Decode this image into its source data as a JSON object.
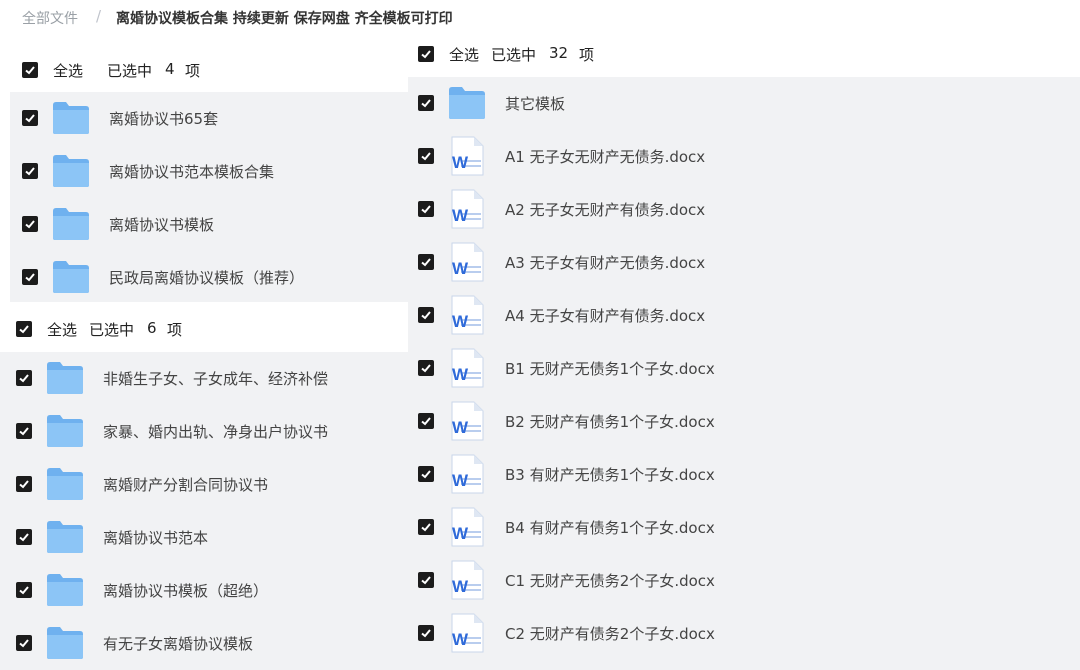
{
  "breadcrumb": {
    "root": "全部文件",
    "separator": "/",
    "current": "离婚协议模板合集 持续更新 保存网盘 齐全模板可打印"
  },
  "panel_a": {
    "select_all": "全选",
    "selected_prefix": "已选中",
    "selected_count": "4",
    "selected_suffix": "项",
    "items": [
      {
        "name": "离婚协议书65套",
        "icon": "folder-icon"
      },
      {
        "name": "离婚协议书范本模板合集",
        "icon": "folder-icon"
      },
      {
        "name": "离婚协议书模板",
        "icon": "folder-icon"
      },
      {
        "name": "民政局离婚协议模板（推荐）",
        "icon": "folder-icon"
      }
    ]
  },
  "panel_b": {
    "select_all": "全选",
    "selected_prefix": "已选中",
    "selected_count": "6",
    "selected_suffix": "项",
    "items": [
      {
        "name": "非婚生子女、子女成年、经济补偿",
        "icon": "folder-icon"
      },
      {
        "name": "家暴、婚内出轨、净身出户协议书",
        "icon": "folder-icon"
      },
      {
        "name": "离婚财产分割合同协议书",
        "icon": "folder-icon"
      },
      {
        "name": "离婚协议书范本",
        "icon": "folder-icon"
      },
      {
        "name": "离婚协议书模板（超绝）",
        "icon": "folder-icon"
      },
      {
        "name": "有无子女离婚协议模板",
        "icon": "folder-icon"
      }
    ]
  },
  "panel_c": {
    "select_all": "全选",
    "selected_prefix": "已选中",
    "selected_count": "32",
    "selected_suffix": "项",
    "items": [
      {
        "name": "其它模板",
        "icon": "folder-icon"
      },
      {
        "name": "A1 无子女无财产无债务.docx",
        "icon": "word-doc-icon"
      },
      {
        "name": "A2 无子女无财产有债务.docx",
        "icon": "word-doc-icon"
      },
      {
        "name": "A3 无子女有财产无债务.docx",
        "icon": "word-doc-icon"
      },
      {
        "name": "A4 无子女有财产有债务.docx",
        "icon": "word-doc-icon"
      },
      {
        "name": "B1 无财产无债务1个子女.docx",
        "icon": "word-doc-icon"
      },
      {
        "name": "B2 无财产有债务1个子女.docx",
        "icon": "word-doc-icon"
      },
      {
        "name": "B3 有财产无债务1个子女.docx",
        "icon": "word-doc-icon"
      },
      {
        "name": "B4 有财产有债务1个子女.docx",
        "icon": "word-doc-icon"
      },
      {
        "name": "C1 无财产无债务2个子女.docx",
        "icon": "word-doc-icon"
      },
      {
        "name": "C2 无财产有债务2个子女.docx",
        "icon": "word-doc-icon"
      }
    ]
  },
  "colors": {
    "panel_bg": "#f1f2f4",
    "folder": "#7cb9f2",
    "word_blue": "#2f6ad9",
    "checkbox": "#1c1c1c"
  }
}
